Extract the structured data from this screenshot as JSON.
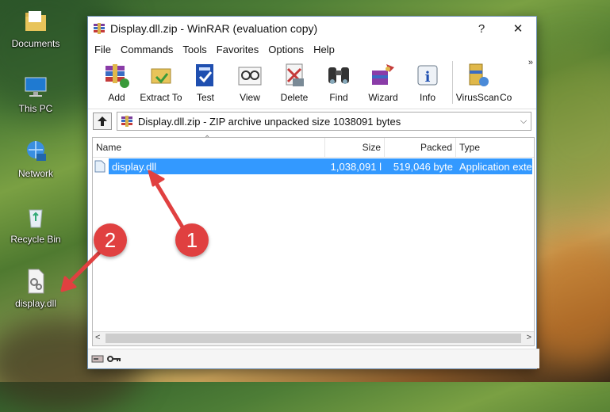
{
  "desktop": {
    "icons": [
      {
        "label": "Documents",
        "icon": "folder-icon"
      },
      {
        "label": "This PC",
        "icon": "computer-icon"
      },
      {
        "label": "Network",
        "icon": "network-icon"
      },
      {
        "label": "Recycle Bin",
        "icon": "recycle-bin-icon"
      },
      {
        "label": "display.dll",
        "icon": "dll-file-icon"
      }
    ]
  },
  "window": {
    "title": "Display.dll.zip - WinRAR (evaluation copy)",
    "help_glyph": "?",
    "close_glyph": "✕",
    "menu": [
      "File",
      "Commands",
      "Tools",
      "Favorites",
      "Options",
      "Help"
    ],
    "toolbar": [
      {
        "label": "Add",
        "icon": "add-archive-icon"
      },
      {
        "label": "Extract To",
        "icon": "extract-icon"
      },
      {
        "label": "Test",
        "icon": "test-icon"
      },
      {
        "label": "View",
        "icon": "view-icon"
      },
      {
        "label": "Delete",
        "icon": "delete-icon"
      },
      {
        "label": "Find",
        "icon": "find-icon"
      },
      {
        "label": "Wizard",
        "icon": "wizard-icon"
      },
      {
        "label": "Info",
        "icon": "info-icon"
      },
      {
        "label": "VirusScan",
        "icon": "virusscan-icon"
      },
      {
        "label": "Co",
        "icon": "comment-icon"
      }
    ],
    "overflow_glyph": "»",
    "address": "Display.dll.zip - ZIP archive unpacked size 1038091 bytes",
    "columns": [
      "Name",
      "Size",
      "Packed",
      "Type"
    ],
    "rows": [
      {
        "name": "display.dll",
        "size": "1,038,091 l",
        "packed": "519,046 byte",
        "type": "Application exte"
      }
    ],
    "scroll_left": "<",
    "scroll_right": ">"
  },
  "callouts": [
    "1",
    "2"
  ],
  "colors": {
    "selection": "#3399ff",
    "callout": "#e04040",
    "window_border": "#6d8fb3"
  }
}
